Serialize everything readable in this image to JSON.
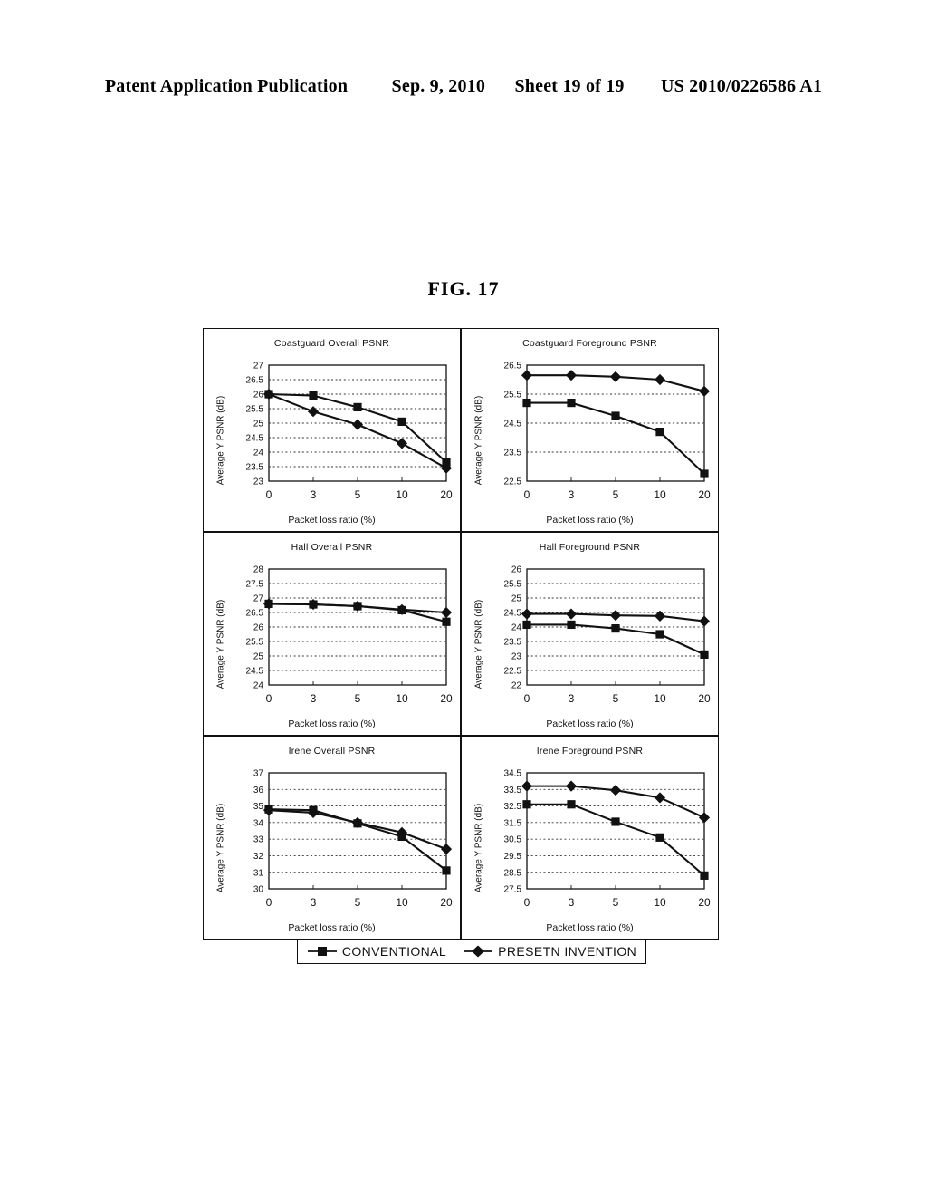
{
  "header": {
    "publication": "Patent Application Publication",
    "date": "Sep. 9, 2010",
    "sheet": "Sheet 19 of 19",
    "patent_number": "US 2010/0226586 A1"
  },
  "figure": {
    "label": "FIG.  17"
  },
  "legend": {
    "series1_label": "CONVENTIONAL",
    "series1_marker": "square-marker-icon",
    "series2_label": "PRESETN INVENTION",
    "series2_marker": "diamond-marker-icon"
  },
  "axis_common": {
    "xlabel": "Packet loss ratio (%)",
    "ylabel": "Average Y PSNR (dB)",
    "xticks": [
      "0",
      "3",
      "5",
      "10",
      "20"
    ]
  },
  "chart_data": [
    {
      "id": "coastguard-overall",
      "type": "line",
      "title": "Coastguard Overall PSNR",
      "xlabel": "Packet loss ratio (%)",
      "ylabel": "Average Y PSNR (dB)",
      "categories": [
        "0",
        "3",
        "5",
        "10",
        "20"
      ],
      "x": [
        0,
        3,
        5,
        10,
        20
      ],
      "ylim": [
        23,
        27
      ],
      "ytick_step": 0.5,
      "yticks": [
        "27",
        "26.5",
        "26",
        "25.5",
        "25",
        "24.5",
        "24",
        "23.5",
        "23"
      ],
      "grid": true,
      "legend_position": "bottom-external",
      "series": [
        {
          "name": "CONVENTIONAL",
          "marker": "square",
          "values": [
            26.0,
            25.95,
            25.55,
            25.05,
            23.65
          ]
        },
        {
          "name": "PRESETN INVENTION",
          "marker": "diamond",
          "values": [
            26.0,
            25.4,
            24.95,
            24.3,
            23.45
          ]
        }
      ]
    },
    {
      "id": "coastguard-foreground",
      "type": "line",
      "title": "Coastguard Foreground PSNR",
      "xlabel": "Packet loss ratio (%)",
      "ylabel": "Average Y PSNR (dB)",
      "categories": [
        "0",
        "3",
        "5",
        "10",
        "20"
      ],
      "x": [
        0,
        3,
        5,
        10,
        20
      ],
      "ylim": [
        22.5,
        26.5
      ],
      "ytick_step": 1.0,
      "yticks": [
        "26.5",
        "25.5",
        "24.5",
        "23.5",
        "22.5"
      ],
      "grid": true,
      "legend_position": "bottom-external",
      "series": [
        {
          "name": "CONVENTIONAL",
          "marker": "square",
          "values": [
            25.2,
            25.2,
            24.75,
            24.2,
            22.75
          ]
        },
        {
          "name": "PRESETN INVENTION",
          "marker": "diamond",
          "values": [
            26.15,
            26.15,
            26.1,
            26.0,
            25.6
          ]
        }
      ]
    },
    {
      "id": "hall-overall",
      "type": "line",
      "title": "Hall Overall PSNR",
      "xlabel": "Packet loss ratio (%)",
      "ylabel": "Average Y PSNR (dB)",
      "categories": [
        "0",
        "3",
        "5",
        "10",
        "20"
      ],
      "x": [
        0,
        3,
        5,
        10,
        20
      ],
      "ylim": [
        24,
        28
      ],
      "ytick_step": 0.5,
      "yticks": [
        "28",
        "27.5",
        "27",
        "26.5",
        "26",
        "25.5",
        "25",
        "24.5",
        "24"
      ],
      "grid": true,
      "legend_position": "bottom-external",
      "series": [
        {
          "name": "CONVENTIONAL",
          "marker": "square",
          "values": [
            26.8,
            26.78,
            26.72,
            26.58,
            26.18
          ]
        },
        {
          "name": "PRESETN INVENTION",
          "marker": "diamond",
          "values": [
            26.8,
            26.78,
            26.72,
            26.6,
            26.5
          ]
        }
      ]
    },
    {
      "id": "hall-foreground",
      "type": "line",
      "title": "Hall Foreground PSNR",
      "xlabel": "Packet loss ratio (%)",
      "ylabel": "Average Y PSNR (dB)",
      "categories": [
        "0",
        "3",
        "5",
        "10",
        "20"
      ],
      "x": [
        0,
        3,
        5,
        10,
        20
      ],
      "ylim": [
        22,
        26
      ],
      "ytick_step": 0.5,
      "yticks": [
        "26",
        "25.5",
        "25",
        "24.5",
        "24",
        "23.5",
        "23",
        "22.5",
        "22"
      ],
      "grid": true,
      "legend_position": "bottom-external",
      "series": [
        {
          "name": "CONVENTIONAL",
          "marker": "square",
          "values": [
            24.08,
            24.08,
            23.95,
            23.75,
            23.05
          ]
        },
        {
          "name": "PRESETN INVENTION",
          "marker": "diamond",
          "values": [
            24.45,
            24.45,
            24.4,
            24.38,
            24.2
          ]
        }
      ]
    },
    {
      "id": "irene-overall",
      "type": "line",
      "title": "Irene Overall  PSNR",
      "xlabel": "Packet loss ratio (%)",
      "ylabel": "Average Y PSNR (dB)",
      "categories": [
        "0",
        "3",
        "5",
        "10",
        "20"
      ],
      "x": [
        0,
        3,
        5,
        10,
        20
      ],
      "ylim": [
        30,
        37
      ],
      "ytick_step": 1.0,
      "yticks": [
        "37",
        "36",
        "35",
        "34",
        "33",
        "32",
        "31",
        "30"
      ],
      "grid": true,
      "legend_position": "bottom-external",
      "series": [
        {
          "name": "CONVENTIONAL",
          "marker": "square",
          "values": [
            34.8,
            34.75,
            33.95,
            33.15,
            31.1
          ]
        },
        {
          "name": "PRESETN INVENTION",
          "marker": "diamond",
          "values": [
            34.75,
            34.6,
            34.0,
            33.4,
            32.4
          ]
        }
      ]
    },
    {
      "id": "irene-foreground",
      "type": "line",
      "title": "Irene Foreground PSNR",
      "xlabel": "Packet loss ratio (%)",
      "ylabel": "Average Y PSNR (dB)",
      "categories": [
        "0",
        "3",
        "5",
        "10",
        "20"
      ],
      "x": [
        0,
        3,
        5,
        10,
        20
      ],
      "ylim": [
        27.5,
        34.5
      ],
      "ytick_step": 1.0,
      "yticks": [
        "34.5",
        "33.5",
        "32.5",
        "31.5",
        "30.5",
        "29.5",
        "28.5",
        "27.5"
      ],
      "grid": true,
      "legend_position": "bottom-external",
      "series": [
        {
          "name": "CONVENTIONAL",
          "marker": "square",
          "values": [
            32.6,
            32.6,
            31.55,
            30.6,
            28.3
          ]
        },
        {
          "name": "PRESETN INVENTION",
          "marker": "diamond",
          "values": [
            33.7,
            33.7,
            33.45,
            33.0,
            31.8
          ]
        }
      ]
    }
  ]
}
